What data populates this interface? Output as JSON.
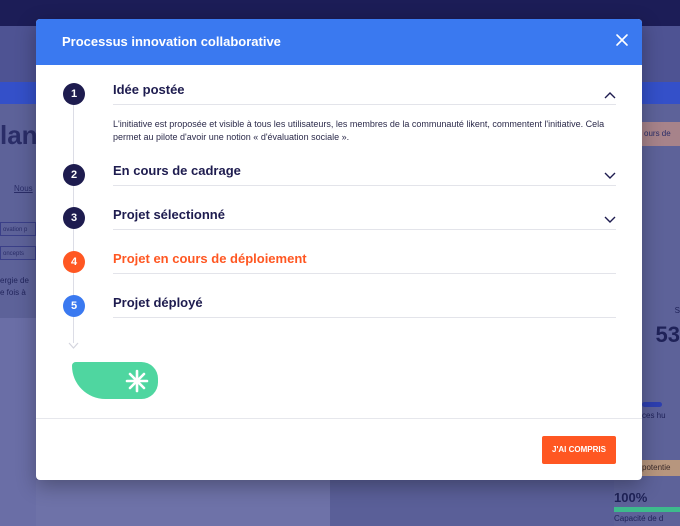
{
  "background": {
    "page_title": "lant",
    "badge": "ours de",
    "link": "Nous",
    "tags": [
      "ovation p",
      "oncepts"
    ],
    "text_lines": [
      "ergie de",
      "e fois à"
    ],
    "right_small": "S",
    "right_number": "53",
    "right_caption": "ces hu",
    "right_pill": "potentie",
    "right_percent": "100%",
    "right_capacity": "Capacité de d"
  },
  "modal": {
    "title": "Processus innovation collaborative",
    "close_icon": "close-icon",
    "steps": [
      {
        "number": "1",
        "title": "Idée postée",
        "state": "expanded",
        "color": "#1e1c4f",
        "description": "L'initiative est proposée et visible à tous les utilisateurs, les membres de la communauté likent, commentent l'initiative. Cela permet au pilote d'avoir une notion « d'évaluation sociale »."
      },
      {
        "number": "2",
        "title": "En cours de cadrage",
        "state": "collapsed",
        "color": "#1e1c4f"
      },
      {
        "number": "3",
        "title": "Projet sélectionné",
        "state": "collapsed",
        "color": "#1e1c4f"
      },
      {
        "number": "4",
        "title": "Projet en cours de déploiement",
        "state": "current",
        "color": "#ff5722"
      },
      {
        "number": "5",
        "title": "Projet déployé",
        "state": "none",
        "color": "#3a79f0"
      }
    ],
    "ok_button": "J'AI COMPRIS"
  },
  "colors": {
    "header_blue": "#3a79f0",
    "dark_navy": "#1e1c4f",
    "accent_orange": "#ff5722",
    "mint_green": "#4fd6a0"
  }
}
